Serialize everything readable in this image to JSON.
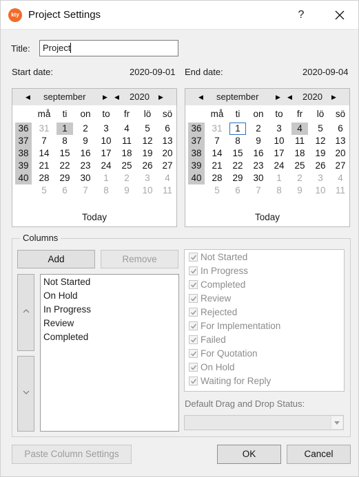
{
  "window": {
    "title": "Project Settings",
    "app_icon_text": "kty",
    "help_label": "?"
  },
  "form": {
    "title_label": "Title:",
    "title_value": "Project",
    "start_date_label": "Start date:",
    "start_date_value": "2020-09-01",
    "end_date_label": "End date:",
    "end_date_value": "2020-09-04"
  },
  "calendars": [
    {
      "month": "september",
      "year": "2020",
      "weekday_headers": [
        "må",
        "ti",
        "on",
        "to",
        "fr",
        "lö",
        "sö"
      ],
      "weeks": [
        {
          "num": "36",
          "days": [
            "31",
            "1",
            "2",
            "3",
            "4",
            "5",
            "6"
          ],
          "muted": [
            true,
            false,
            false,
            false,
            false,
            false,
            false
          ]
        },
        {
          "num": "37",
          "days": [
            "7",
            "8",
            "9",
            "10",
            "11",
            "12",
            "13"
          ],
          "muted": [
            false,
            false,
            false,
            false,
            false,
            false,
            false
          ]
        },
        {
          "num": "38",
          "days": [
            "14",
            "15",
            "16",
            "17",
            "18",
            "19",
            "20"
          ],
          "muted": [
            false,
            false,
            false,
            false,
            false,
            false,
            false
          ]
        },
        {
          "num": "39",
          "days": [
            "21",
            "22",
            "23",
            "24",
            "25",
            "26",
            "27"
          ],
          "muted": [
            false,
            false,
            false,
            false,
            false,
            false,
            false
          ]
        },
        {
          "num": "40",
          "days": [
            "28",
            "29",
            "30",
            "1",
            "2",
            "3",
            "4"
          ],
          "muted": [
            false,
            false,
            false,
            true,
            true,
            true,
            true
          ]
        },
        {
          "num": "",
          "days": [
            "5",
            "6",
            "7",
            "8",
            "9",
            "10",
            "11"
          ],
          "muted": [
            true,
            true,
            true,
            true,
            true,
            true,
            true
          ]
        }
      ],
      "selected": {
        "week": 0,
        "day": 1
      },
      "today_box": null,
      "today_label": "Today"
    },
    {
      "month": "september",
      "year": "2020",
      "weekday_headers": [
        "må",
        "ti",
        "on",
        "to",
        "fr",
        "lö",
        "sö"
      ],
      "weeks": [
        {
          "num": "36",
          "days": [
            "31",
            "1",
            "2",
            "3",
            "4",
            "5",
            "6"
          ],
          "muted": [
            true,
            false,
            false,
            false,
            false,
            false,
            false
          ]
        },
        {
          "num": "37",
          "days": [
            "7",
            "8",
            "9",
            "10",
            "11",
            "12",
            "13"
          ],
          "muted": [
            false,
            false,
            false,
            false,
            false,
            false,
            false
          ]
        },
        {
          "num": "38",
          "days": [
            "14",
            "15",
            "16",
            "17",
            "18",
            "19",
            "20"
          ],
          "muted": [
            false,
            false,
            false,
            false,
            false,
            false,
            false
          ]
        },
        {
          "num": "39",
          "days": [
            "21",
            "22",
            "23",
            "24",
            "25",
            "26",
            "27"
          ],
          "muted": [
            false,
            false,
            false,
            false,
            false,
            false,
            false
          ]
        },
        {
          "num": "40",
          "days": [
            "28",
            "29",
            "30",
            "1",
            "2",
            "3",
            "4"
          ],
          "muted": [
            false,
            false,
            false,
            true,
            true,
            true,
            true
          ]
        },
        {
          "num": "",
          "days": [
            "5",
            "6",
            "7",
            "8",
            "9",
            "10",
            "11"
          ],
          "muted": [
            true,
            true,
            true,
            true,
            true,
            true,
            true
          ]
        }
      ],
      "selected": {
        "week": 0,
        "day": 4
      },
      "today_box": {
        "week": 0,
        "day": 1
      },
      "today_label": "Today"
    }
  ],
  "columns": {
    "group_label": "Columns",
    "add_label": "Add",
    "remove_label": "Remove",
    "up_icon": "chevron-up-icon",
    "down_icon": "chevron-down-icon",
    "list_items": [
      "Not Started",
      "On Hold",
      "In Progress",
      "Review",
      "Completed"
    ],
    "status_options": [
      {
        "label": "Not Started",
        "checked": true
      },
      {
        "label": "In Progress",
        "checked": true
      },
      {
        "label": "Completed",
        "checked": true
      },
      {
        "label": "Review",
        "checked": true
      },
      {
        "label": "Rejected",
        "checked": true
      },
      {
        "label": "For Implementation",
        "checked": true
      },
      {
        "label": "Failed",
        "checked": true
      },
      {
        "label": "For Quotation",
        "checked": true
      },
      {
        "label": "On Hold",
        "checked": true
      },
      {
        "label": "Waiting for Reply",
        "checked": true
      }
    ],
    "default_drop_label": "Default Drag and Drop Status:",
    "default_drop_value": ""
  },
  "footer": {
    "paste_label": "Paste Column Settings",
    "ok_label": "OK",
    "cancel_label": "Cancel"
  },
  "colors": {
    "accent": "#2a6fb8",
    "app_icon": "#f26b2a",
    "week_column": "#c8c8c8"
  }
}
